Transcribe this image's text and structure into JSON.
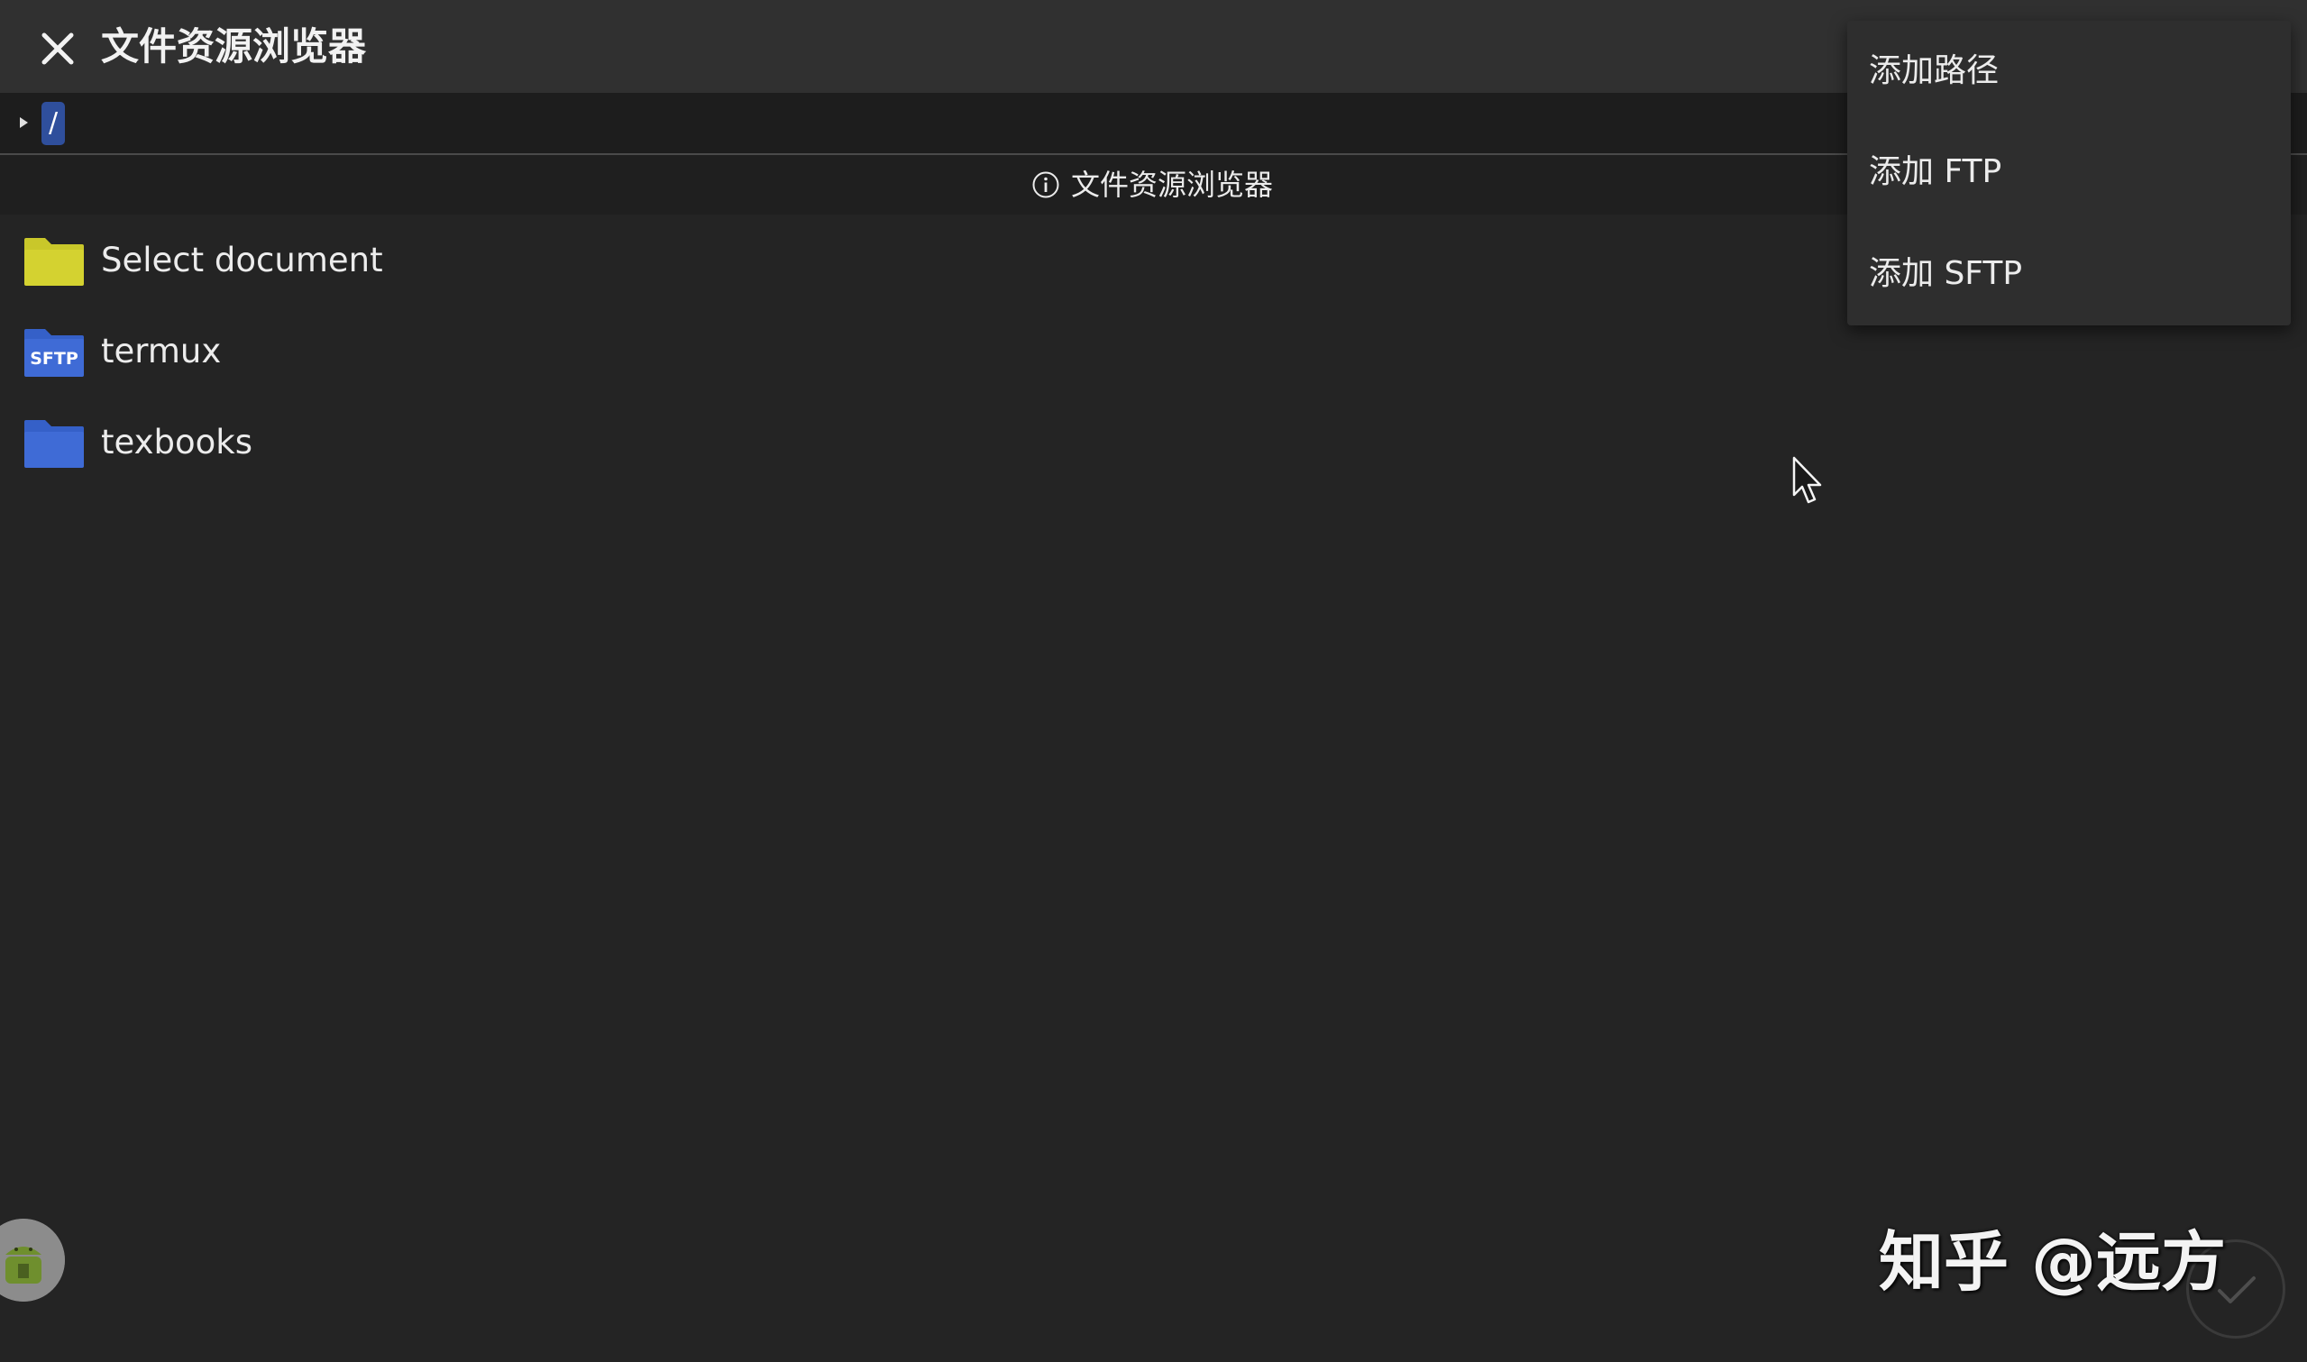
{
  "header": {
    "title": "文件资源浏览器",
    "close_icon": "close-icon"
  },
  "pathbar": {
    "toggle_icon": "caret-right-icon",
    "current_path": "/"
  },
  "infobar": {
    "icon": "info-icon",
    "text": "文件资源浏览器"
  },
  "files": [
    {
      "label": "Select document",
      "icon": "folder-icon",
      "color": "#d4d230"
    },
    {
      "label": "termux",
      "icon": "sftp-folder-icon",
      "color": "#3f6bd6",
      "badge": "SFTP"
    },
    {
      "label": "texbooks",
      "icon": "folder-icon",
      "color": "#3f6bd6"
    }
  ],
  "menu": {
    "items": [
      {
        "label": "添加路径"
      },
      {
        "label": "添加 FTP"
      },
      {
        "label": "添加 SFTP"
      }
    ]
  },
  "confirm_icon": "check-icon",
  "app_icon": "android-app-icon",
  "watermark": "知乎 @远方",
  "colors": {
    "background": "#242424",
    "titlebar": "#303030",
    "menu_bg": "#2e2e2e",
    "path_chip": "#2f4f9c",
    "folder_yellow": "#d4d230",
    "folder_blue": "#3f6bd6"
  }
}
